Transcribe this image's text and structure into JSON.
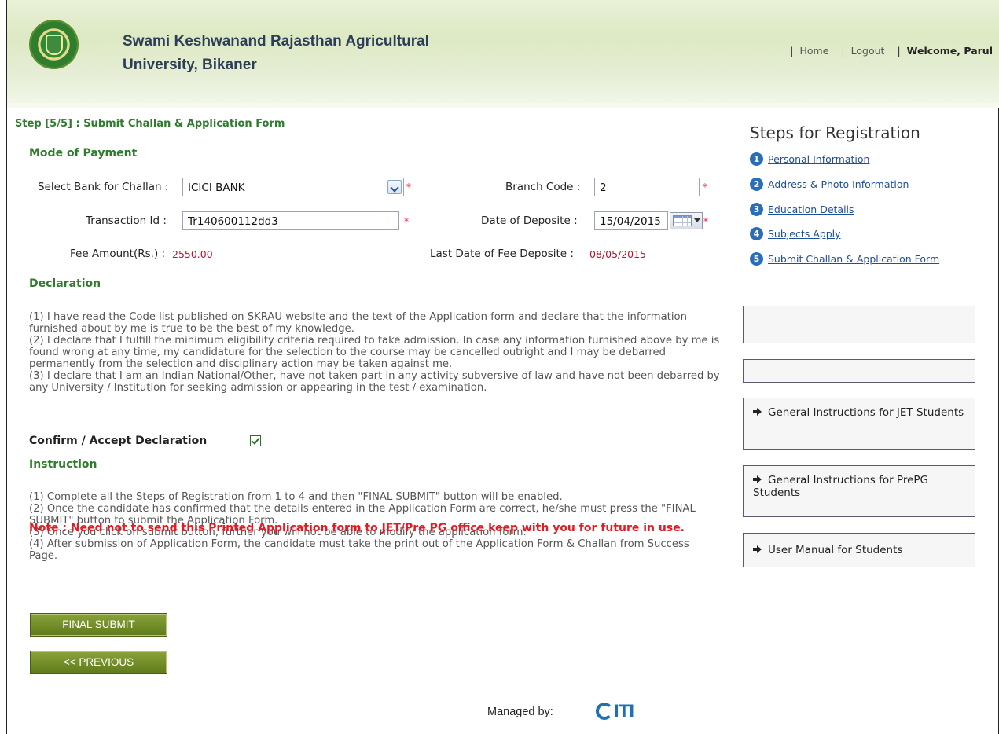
{
  "header": {
    "university_line1": "Swami Keshwanand Rajasthan Agricultural",
    "university_line2": "University, Bikaner",
    "nav": {
      "home": "Home",
      "logout": "Logout",
      "welcome": "Welcome, Parul"
    }
  },
  "step_title": "Step [5/5] : Submit Challan & Application Form",
  "payment": {
    "section_title": "Mode of Payment",
    "bank_label": "Select Bank for Challan :",
    "bank_value": "ICICI BANK",
    "branch_label": "Branch Code :",
    "branch_value": "2",
    "txn_label": "Transaction Id :",
    "txn_value": "Tr140600112dd3",
    "date_label": "Date of Deposite :",
    "date_value": "15/04/2015",
    "fee_label": "Fee Amount(Rs.) :",
    "fee_value": "2550.00",
    "last_date_label": "Last Date of Fee Deposite :",
    "last_date_value": "08/05/2015",
    "required_mark": "*"
  },
  "declaration": {
    "section_title": "Declaration",
    "items": [
      "(1)   I have read the Code list published on SKRAU website and the text of the Application form and declare that the information furnished about by me is true to be the best of my knowledge.",
      "(2)   I declare that I fulfill the minimum eligibility criteria required to take admission. In case any information furnished above by me is found wrong at any time, my candidature for the selection to the course may be cancelled outright and I may be debarred permanently from the selection and disciplinary action may be taken against me.",
      "(3)   I declare that I am an Indian National/Other, have not taken part in any activity subversive of law and have not been debarred by any University / Institution for seeking admission or appearing in the test / examination."
    ],
    "confirm_label": "Confirm / Accept Declaration",
    "confirm_checked": true
  },
  "instruction": {
    "section_title": "Instruction",
    "items": [
      "(1)    Complete all the Steps of Registration from 1 to 4 and then \"FINAL SUBMIT\" button will be enabled.",
      "(2)    Once the candidate has confirmed that the details entered in the Application Form are correct, he/she must press the \"FINAL SUBMIT\" button to submit the Application Form.",
      "(3)    Once you click on submit button, further you will not be able to modify the application form.",
      "(4)    After submission of Application Form, the candidate must take the print out of the Application Form & Challan from Success Page."
    ],
    "note": "Note : Need not to send this Printed Application form to JET/Pre PG office keep with you for future in use."
  },
  "buttons": {
    "final_submit": "FINAL SUBMIT",
    "previous": "<< PREVIOUS"
  },
  "footer": {
    "managed_by": "Managed by:",
    "logo_text": "ITI"
  },
  "sidebar": {
    "title": "Steps for Registration",
    "steps": [
      {
        "num": "1",
        "label": "Personal Information"
      },
      {
        "num": "2",
        "label": "Address & Photo Information"
      },
      {
        "num": "3",
        "label": "Education Details"
      },
      {
        "num": "4",
        "label": "Subjects Apply"
      },
      {
        "num": "5",
        "label": "Submit Challan & Application Form"
      }
    ],
    "links": [
      "General Instructions for JET Students",
      "General Instructions for PrePG Students",
      "User Manual for Students"
    ]
  },
  "colors": {
    "accent_green": "#2d7d2d",
    "required_red": "#e2213c",
    "button_olive": "#6f8a24",
    "link_blue": "#1d4f9c"
  }
}
